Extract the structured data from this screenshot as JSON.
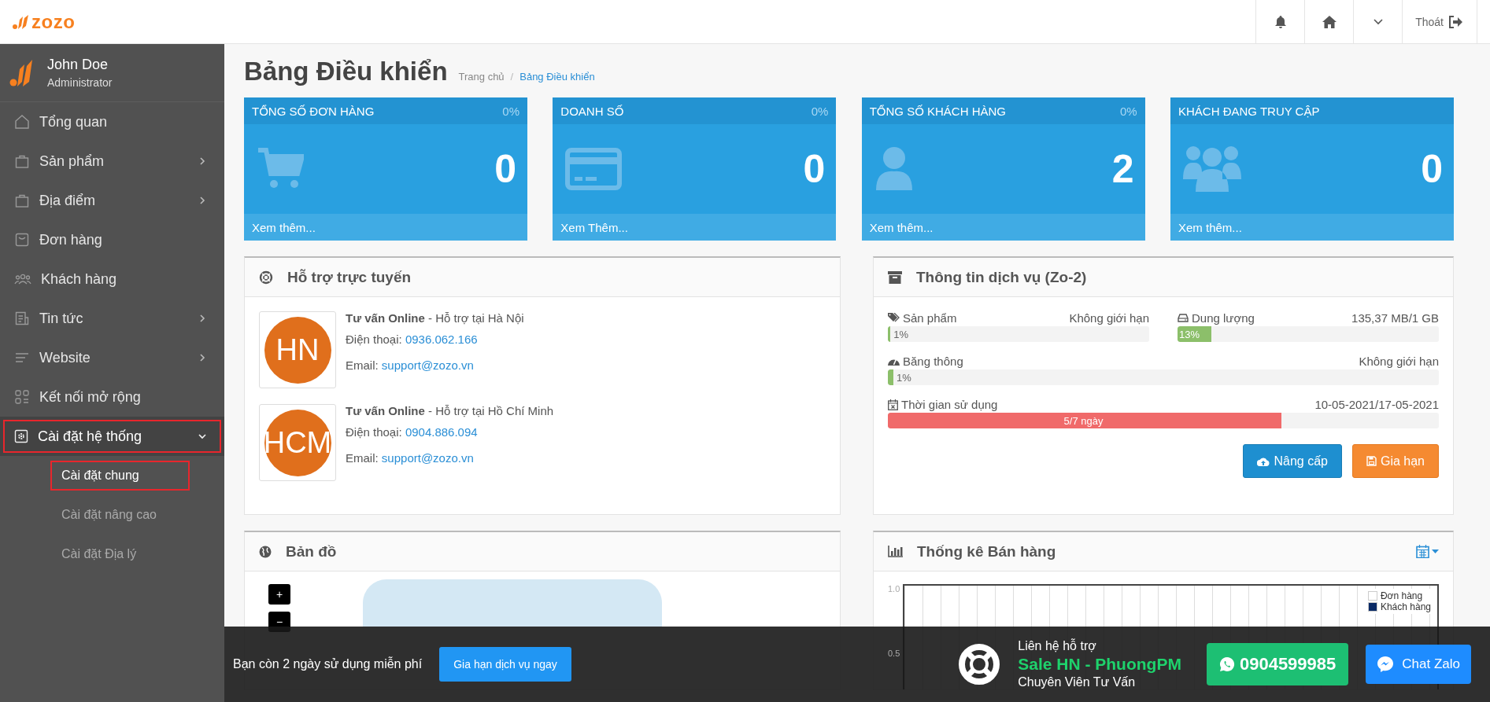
{
  "topbar": {
    "logo": "zozo",
    "logout": "Thoát"
  },
  "user": {
    "name": "John Doe",
    "role": "Administrator"
  },
  "sidebar": {
    "items": [
      {
        "label": "Tổng quan",
        "has_submenu": false,
        "expanded": false,
        "highlighted": false
      },
      {
        "label": "Sản phẩm",
        "has_submenu": true,
        "expanded": false,
        "highlighted": false
      },
      {
        "label": "Địa điểm",
        "has_submenu": true,
        "expanded": false,
        "highlighted": false
      },
      {
        "label": "Đơn hàng",
        "has_submenu": false,
        "expanded": false,
        "highlighted": false
      },
      {
        "label": "Khách hàng",
        "has_submenu": false,
        "expanded": false,
        "highlighted": false
      },
      {
        "label": "Tin tức",
        "has_submenu": true,
        "expanded": false,
        "highlighted": false
      },
      {
        "label": "Website",
        "has_submenu": true,
        "expanded": false,
        "highlighted": false
      },
      {
        "label": "Kết nối mở rộng",
        "has_submenu": false,
        "expanded": false,
        "highlighted": false
      },
      {
        "label": "Cài đặt hệ thống",
        "has_submenu": true,
        "expanded": true,
        "highlighted": true,
        "children": [
          {
            "label": "Cài đặt chung",
            "selected": true,
            "highlighted": true
          },
          {
            "label": "Cài đặt nâng cao",
            "selected": false,
            "highlighted": false
          },
          {
            "label": "Cài đặt Địa lý",
            "selected": false,
            "highlighted": false
          }
        ]
      }
    ]
  },
  "page": {
    "title": "Bảng Điều khiển",
    "breadcrumb_separator": "/",
    "breadcrumb": [
      {
        "label": "Trang chủ",
        "current": false
      },
      {
        "label": "Bảng Điều khiển",
        "current": true
      }
    ]
  },
  "stats": [
    {
      "title": "TỔNG SỐ ĐƠN HÀNG",
      "percent": "0%",
      "value": "0",
      "more": "Xem thêm..."
    },
    {
      "title": "DOANH SỐ",
      "percent": "0%",
      "value": "0",
      "more": "Xem Thêm..."
    },
    {
      "title": "TỔNG SỐ KHÁCH HÀNG",
      "percent": "0%",
      "value": "2",
      "more": "Xem thêm..."
    },
    {
      "title": "KHÁCH ĐANG TRUY CẬP",
      "value": "0",
      "more": "Xem thêm..."
    }
  ],
  "support": {
    "title": "Hỗ trợ trực tuyến",
    "contacts": [
      {
        "avatar": "HN",
        "name": "Tư vấn Online",
        "place": " - Hỗ trợ tại Hà Nội",
        "phone_label": "Điện thoại:",
        "phone": "0936.062.166",
        "email_label": "Email:",
        "email": "support@zozo.vn"
      },
      {
        "avatar": "HCM",
        "name": "Tư vấn Online",
        "place": " - Hỗ trợ tại Hồ Chí Minh",
        "phone_label": "Điện thoại:",
        "phone": "0904.886.094",
        "email_label": "Email:",
        "email": "support@zozo.vn"
      }
    ]
  },
  "service": {
    "title": "Thông tin dịch vụ (Zo-2)",
    "meters": [
      {
        "label": "Sản phẩm",
        "limit": "Không giới hạn",
        "level": 0.01,
        "reading": "1%",
        "color": "#8cbf6a"
      },
      {
        "label": "Dung lượng",
        "limit": "135,37 MB/1 GB",
        "level": 0.13,
        "reading": "13%",
        "color": "#8cbf6a"
      },
      {
        "label": "Băng thông",
        "limit": "Không giới hạn",
        "level": 0.01,
        "reading": "1%",
        "color": "#8cbf6a"
      },
      {
        "label": "Thời gian sử dụng",
        "limit": "10-05-2021/17-05-2021",
        "level": 0.714,
        "reading": "5/7 ngày",
        "color": "#f06a6a"
      }
    ],
    "buttons": [
      {
        "label": "Nâng cấp",
        "kind": "upgrade"
      },
      {
        "label": "Gia hạn",
        "kind": "renew"
      }
    ]
  },
  "map": {
    "title": "Bản đồ",
    "zoom_in": "+",
    "zoom_out": "−"
  },
  "sales": {
    "title": "Thống kê Bán hàng",
    "yticks": [
      "1.0",
      "0.5"
    ],
    "legend": [
      "Đơn hàng",
      "Khách hàng"
    ]
  },
  "trial_bar": {
    "message": "Bạn còn 2 ngày sử dụng miễn phí",
    "button": "Gia hạn dịch vụ ngay",
    "contact_title": "Liên hệ hỗ trợ",
    "contact_name": "Sale HN - PhuongPM",
    "contact_role": "Chuyên Viên Tư Vấn",
    "phone": "0904599985",
    "chat": "Chat Zalo"
  }
}
